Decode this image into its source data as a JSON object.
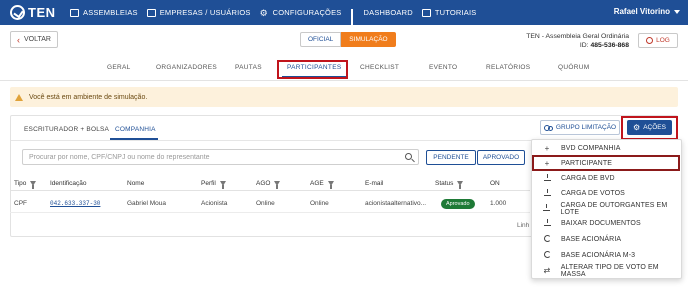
{
  "nav": {
    "brand": "TEN",
    "items": [
      {
        "label": "ASSEMBLEIAS",
        "icon": "calendar-icon"
      },
      {
        "label": "EMPRESAS / USUÁRIOS",
        "icon": "users-icon"
      },
      {
        "label": "CONFIGURAÇÕES",
        "icon": "gear-users-icon"
      },
      {
        "label": "DASHBOARD",
        "icon": "bar-chart-icon"
      },
      {
        "label": "TUTORIAIS",
        "icon": "edit-icon"
      }
    ],
    "user": "Rafael Vitorino"
  },
  "header": {
    "back_label": "VOLTAR",
    "mode_official": "OFICIAL",
    "mode_simulation": "SIMULAÇÃO",
    "assembly_title": "TEN - Assembleia Geral Ordinária",
    "id_label": "ID:",
    "id_value": "485-536-868",
    "log_label": "LOG"
  },
  "tabs": [
    "GERAL",
    "ORGANIZADORES",
    "PAUTAS",
    "PARTICIPANTES",
    "CHECKLIST",
    "EVENTO",
    "RELATÓRIOS",
    "QUÓRUM"
  ],
  "active_tab": "PARTICIPANTES",
  "alert": {
    "text": "Você está em ambiente de simulação."
  },
  "subtabs": [
    "ESCRITURADOR + BOLSA",
    "COMPANHIA"
  ],
  "active_subtab": "COMPANHIA",
  "buttons": {
    "grupo_limitacao": "GRUPO LIMITAÇÃO",
    "acoes": "AÇÕES"
  },
  "search": {
    "placeholder": "Procurar por nome, CPF/CNPJ ou nome do representante"
  },
  "filters": [
    "PENDENTE",
    "APROVADO"
  ],
  "table": {
    "columns": [
      "Tipo",
      "Identificação",
      "Nome",
      "Perfil",
      "AGO",
      "AGE",
      "E-mail",
      "Status",
      "ON"
    ],
    "rows": [
      {
        "tipo": "CPF",
        "identificacao": "042.633.337-30",
        "nome": "Gabriel Moua",
        "perfil": "Acionista",
        "ago": "Online",
        "age": "Online",
        "email": "acionistaalternativo...",
        "status": "Aprovado",
        "on": "1.000"
      }
    ],
    "footer": "Linh"
  },
  "menu": {
    "items": [
      {
        "label": "BVD COMPANHIA",
        "icon": "plus-icon"
      },
      {
        "label": "PARTICIPANTE",
        "icon": "plus-icon"
      },
      {
        "label": "CARGA DE BVD",
        "icon": "upload-icon"
      },
      {
        "label": "CARGA DE VOTOS",
        "icon": "upload-icon"
      },
      {
        "label": "CARGA DE OUTORGANTES EM LOTE",
        "icon": "upload-icon"
      },
      {
        "label": "BAIXAR DOCUMENTOS",
        "icon": "download-icon"
      },
      {
        "label": "BASE ACIONÁRIA",
        "icon": "refresh-icon"
      },
      {
        "label": "BASE ACIONÁRIA M-3",
        "icon": "refresh-icon"
      },
      {
        "label": "ALTERAR TIPO DE VOTO EM MASSA",
        "icon": "swap-icon"
      }
    ]
  },
  "colors": {
    "nav_bg": "#1f4f96",
    "simulation": "#f07d1c",
    "highlight": "#c0141c",
    "approved": "#1e7a36",
    "alert_bg": "#fdf1dc"
  }
}
